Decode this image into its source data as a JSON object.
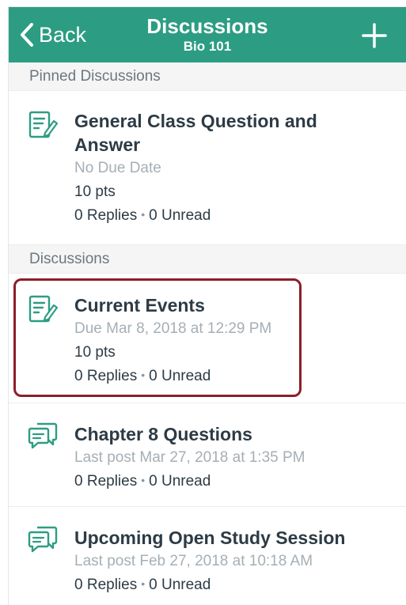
{
  "navbar": {
    "back_label": "Back",
    "title": "Discussions",
    "subtitle": "Bio 101"
  },
  "sections": {
    "pinned_label": "Pinned Discussions",
    "discussions_label": "Discussions"
  },
  "items": [
    {
      "title": "General Class Question and Answer",
      "title_line1": "General Class Question and",
      "title_line2": "Answer",
      "meta": "No Due Date",
      "points": "10 pts",
      "replies": "0 Replies",
      "unread": "0 Unread",
      "icon": "assignment-edit-icon"
    },
    {
      "title": "Current Events",
      "meta": "Due Mar 8, 2018 at 12:29 PM",
      "points": "10 pts",
      "replies": "0 Replies",
      "unread": "0 Unread",
      "icon": "assignment-edit-icon",
      "highlighted": true
    },
    {
      "title": "Chapter 8 Questions",
      "meta": "Last post Mar 27, 2018 at 1:35 PM",
      "replies": "0 Replies",
      "unread": "0 Unread",
      "icon": "discussion-bubbles-icon"
    },
    {
      "title": "Upcoming Open Study Session",
      "meta": "Last post Feb 27, 2018 at 10:18 AM",
      "replies": "0 Replies",
      "unread": "0 Unread",
      "icon": "discussion-bubbles-icon"
    }
  ],
  "separator": "•",
  "colors": {
    "navbar": "#2c9d83",
    "icon": "#2c9d83",
    "highlight_border": "#8c1f28",
    "title_text": "#2d3b45",
    "meta_text": "#a5afb5",
    "section_text": "#6b7780"
  }
}
